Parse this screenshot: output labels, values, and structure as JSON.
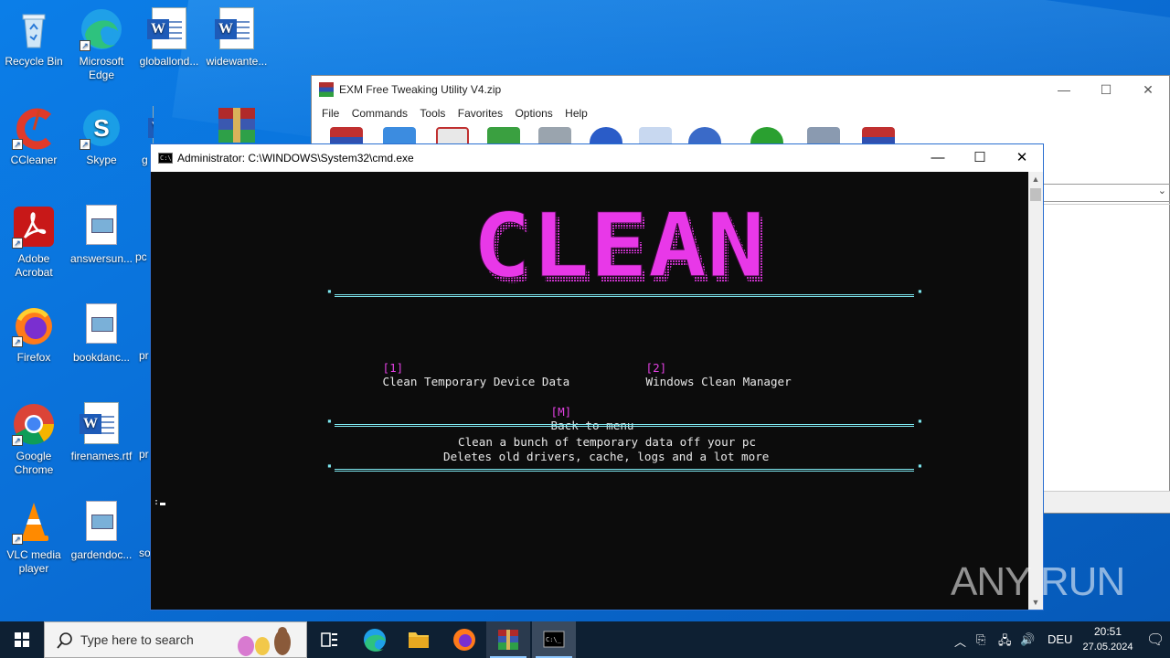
{
  "desktop": {
    "icons": [
      {
        "label": "Recycle Bin"
      },
      {
        "label": "Microsoft Edge"
      },
      {
        "label": "globallond..."
      },
      {
        "label": "widewante..."
      },
      {
        "label": "CCleaner"
      },
      {
        "label": "Skype"
      },
      {
        "label": "g"
      },
      {
        "label": "Adobe Acrobat"
      },
      {
        "label": "answersun..."
      },
      {
        "label": "pc"
      },
      {
        "label": "Firefox"
      },
      {
        "label": "bookdanc..."
      },
      {
        "label": "pr"
      },
      {
        "label": "Google Chrome"
      },
      {
        "label": "firenames.rtf"
      },
      {
        "label": "pr"
      },
      {
        "label": "VLC media player"
      },
      {
        "label": "gardendoc..."
      },
      {
        "label": "so"
      }
    ]
  },
  "winrar": {
    "title": "EXM Free Tweaking Utility V4.zip",
    "menu": [
      "File",
      "Commands",
      "Tools",
      "Favorites",
      "Options",
      "Help"
    ]
  },
  "cmd": {
    "title": "Administrator: C:\\WINDOWS\\System32\\cmd.exe",
    "banner_text": "CLEAN",
    "option1_key": "[1]",
    "option1_label": "Clean Temporary Device Data",
    "option2_key": "[2]",
    "option2_label": "Windows Clean Manager",
    "back_key": "[M]",
    "back_label": "Back to menu",
    "desc_line1": "Clean a bunch of temporary data off your pc",
    "desc_line2": "Deletes old drivers, cache, logs and a lot more"
  },
  "watermark": "ANY RUN",
  "taskbar": {
    "search_placeholder": "Type here to search",
    "language": "DEU",
    "time": "20:51",
    "date": "27.05.2024"
  },
  "colors": {
    "banner_magenta": "#e838e8",
    "separator_cyan": "#7ee8f0",
    "key_magenta": "#e040e0",
    "desktop_blue": "#0a6fd6"
  }
}
